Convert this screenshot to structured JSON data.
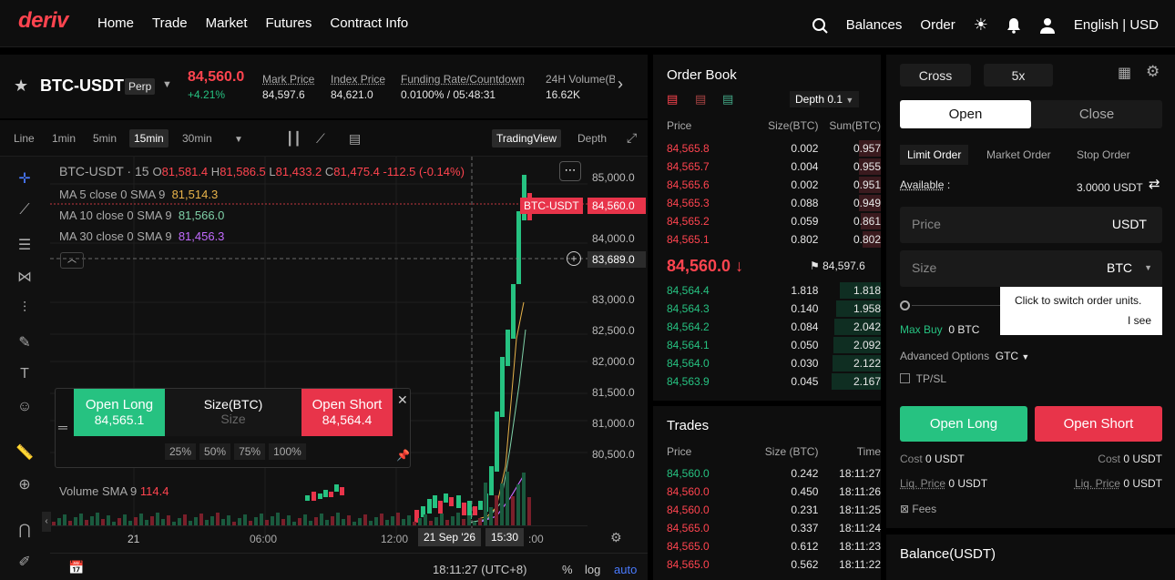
{
  "nav": {
    "logo": "deriv",
    "links": [
      "Home",
      "Trade",
      "Market",
      "Futures",
      "Contract Info"
    ],
    "balances": "Balances",
    "order": "Order",
    "lang": "English | USD"
  },
  "ticker": {
    "symbol": "BTC-USDT",
    "type": "Perp",
    "price": "84,560.0",
    "change": "+4.21%",
    "mark_label": "Mark Price",
    "mark": "84,597.6",
    "index_label": "Index Price",
    "index": "84,621.0",
    "funding_label": "Funding Rate/Countdown",
    "funding": "0.0100% / 05:48:31",
    "vol_label": "24H Volume(B",
    "vol": "16.62K"
  },
  "toolbar": {
    "intervals": [
      "Line",
      "1min",
      "5min",
      "15min",
      "30min"
    ],
    "active": "15min",
    "tradingview": "TradingView",
    "depth": "Depth"
  },
  "chart_legend": {
    "title": "BTC-USDT · 15",
    "o_label": "O",
    "o": "81,581.4",
    "h_label": "H",
    "h": "81,586.5",
    "l_label": "L",
    "l": "81,433.2",
    "c_label": "C",
    "c": "81,475.4",
    "chg": "-112.5",
    "chg_pct": "(-0.14%)",
    "ma5_label": "MA 5 close 0 SMA 9",
    "ma5": "81,514.3",
    "ma10_label": "MA 10 close 0 SMA 9",
    "ma10": "81,566.0",
    "ma30_label": "MA 30 close 0 SMA 9",
    "ma30": "81,456.3",
    "vol_label": "Volume SMA 9",
    "vol": "114.4"
  },
  "yaxis": [
    "85,000.0",
    "84,000.0",
    "83,000.0",
    "82,500.0",
    "82,000.0",
    "81,500.0",
    "81,000.0",
    "80,500.0"
  ],
  "price_tag": {
    "symbol": "BTC-USDT",
    "price": "84,560.0"
  },
  "cross_price": "83,689.0",
  "xaxis": [
    "21",
    "06:00",
    "12:00",
    "21 Sep '26",
    "15:30",
    ":00"
  ],
  "footer": {
    "time": "18:11:27 (UTC+8)",
    "pct": "%",
    "log": "log",
    "auto": "auto"
  },
  "quick": {
    "long": "Open Long",
    "long_price": "84,565.1",
    "size_label": "Size(BTC)",
    "size_ph": "Size",
    "short": "Open Short",
    "short_price": "84,564.4",
    "pcts": [
      "25%",
      "50%",
      "75%",
      "100%"
    ]
  },
  "orderbook": {
    "title": "Order Book",
    "depth": "Depth 0.1",
    "headers": [
      "Price",
      "Size(BTC)",
      "Sum(BTC)"
    ],
    "asks": [
      [
        "84,565.8",
        "0.002",
        "0.957"
      ],
      [
        "84,565.7",
        "0.004",
        "0.955"
      ],
      [
        "84,565.6",
        "0.002",
        "0.951"
      ],
      [
        "84,565.3",
        "0.088",
        "0.949"
      ],
      [
        "84,565.2",
        "0.059",
        "0.861"
      ],
      [
        "84,565.1",
        "0.802",
        "0.802"
      ]
    ],
    "last": "84,560.0",
    "mark": "84,597.6",
    "bids": [
      [
        "84,564.4",
        "1.818",
        "1.818"
      ],
      [
        "84,564.3",
        "0.140",
        "1.958"
      ],
      [
        "84,564.2",
        "0.084",
        "2.042"
      ],
      [
        "84,564.1",
        "0.050",
        "2.092"
      ],
      [
        "84,564.0",
        "0.030",
        "2.122"
      ],
      [
        "84,563.9",
        "0.045",
        "2.167"
      ]
    ]
  },
  "trades": {
    "title": "Trades",
    "headers": [
      "Price",
      "Size (BTC)",
      "Time"
    ],
    "rows": [
      [
        "84,560.0",
        "0.242",
        "18:11:27",
        "g"
      ],
      [
        "84,560.0",
        "0.450",
        "18:11:26",
        "r"
      ],
      [
        "84,560.0",
        "0.231",
        "18:11:25",
        "r"
      ],
      [
        "84,565.0",
        "0.337",
        "18:11:24",
        "r"
      ],
      [
        "84,565.0",
        "0.612",
        "18:11:23",
        "r"
      ],
      [
        "84,565.0",
        "0.562",
        "18:11:22",
        "r"
      ]
    ]
  },
  "form": {
    "margin": "Cross",
    "lev": "5x",
    "open": "Open",
    "close": "Close",
    "types": [
      "Limit Order",
      "Market Order",
      "Stop Order"
    ],
    "avail_label": "Available",
    "avail": "3.0000 USDT",
    "price_ph": "Price",
    "price_unit": "USDT",
    "size_ph": "Size",
    "size_unit": "BTC",
    "tooltip": "Click to switch order units.",
    "tooltip_ok": "I see",
    "maxbuy_label": "Max Buy",
    "maxbuy": "0 BTC",
    "adv_label": "Advanced Options",
    "adv": "GTC",
    "tpsl": "TP/SL",
    "long": "Open Long",
    "short": "Open Short",
    "cost_label": "Cost",
    "cost": "0 USDT",
    "liq_label": "Liq. Price",
    "liq": "0 USDT",
    "fees": "Fees"
  },
  "balance": {
    "title": "Balance(USDT)"
  }
}
